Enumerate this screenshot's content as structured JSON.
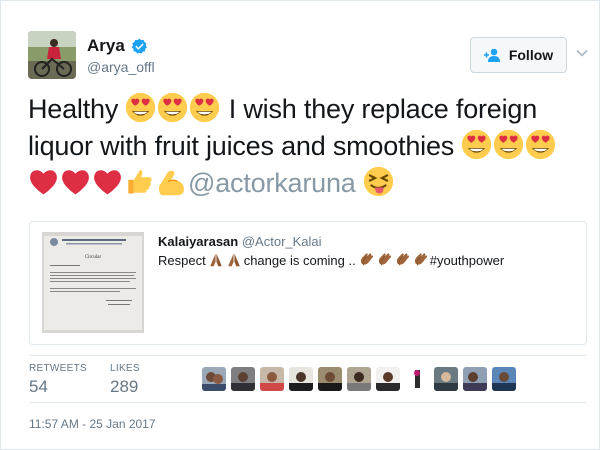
{
  "author": {
    "name": "Arya",
    "handle": "@arya_offl",
    "verified": true
  },
  "follow_button": {
    "label": "Follow",
    "icon": "add-user-icon"
  },
  "tweet": {
    "line1_prefix": "Healthy",
    "line1_text": "I wish they replace foreign",
    "line2_text": "liquor with fruit juices and smoothies",
    "mention": "@actorkaruna",
    "emojis": [
      "heart-eyes",
      "heart",
      "thumbs-up",
      "flexed-biceps",
      "tongue-wink"
    ]
  },
  "quoted_tweet": {
    "name": "Kalaiyarasan",
    "handle": "@Actor_Kalai",
    "text_prefix": "Respect",
    "text_middle": "change is coming ..",
    "hashtag": "#youthpower",
    "image_heading": "Circular",
    "emojis": [
      "folded-hands",
      "clapping-hands"
    ]
  },
  "stats": {
    "retweets_label": "RETWEETS",
    "retweets_value": "54",
    "likes_label": "LIKES",
    "likes_value": "289"
  },
  "timestamp": "11:57 AM - 25 Jan 2017",
  "colors": {
    "text": "#14171a",
    "secondary": "#657786",
    "verified": "#1da1f2",
    "border": "#e1e8ed",
    "heart": "#dd2e44",
    "emoji_face": "#ffcc4d"
  }
}
